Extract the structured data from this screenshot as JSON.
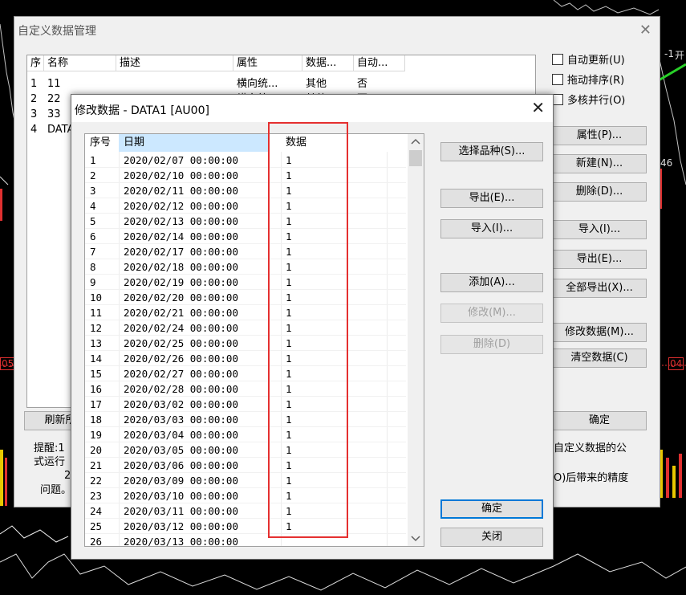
{
  "back_dialog": {
    "title": "自定义数据管理",
    "columns": [
      "序",
      "名称",
      "描述",
      "属性",
      "数据...",
      "自动..."
    ],
    "rows": [
      {
        "no": "1",
        "name": "11",
        "desc": "",
        "attr": "横向统...",
        "data": "其他",
        "auto": "否"
      },
      {
        "no": "2",
        "name": "22",
        "desc": "",
        "attr": "横向统...",
        "data": "其他",
        "auto": "否"
      },
      {
        "no": "3",
        "name": "33",
        "desc": "",
        "attr": "",
        "data": "",
        "auto": ""
      },
      {
        "no": "4",
        "name": "DATA1",
        "desc": "",
        "attr": "",
        "data": "",
        "auto": ""
      }
    ],
    "checkboxes": [
      "自动更新(U)",
      "拖动排序(R)",
      "多核并行(O)"
    ],
    "buttons": {
      "property": "属性(P)...",
      "new": "新建(N)...",
      "delete": "删除(D)...",
      "import": "导入(I)...",
      "export": "导出(E)...",
      "export_all": "全部导出(X)...",
      "modify": "修改数据(M)...",
      "clear": "清空数据(C)",
      "refresh": "刷新所",
      "ok": "确定"
    },
    "notes": {
      "left1": "提醒:1",
      "left2": "式运行",
      "left3": "2",
      "left4": "问题。",
      "right1": "自定义数据的公",
      "right2": "O)后带来的精度"
    }
  },
  "front_dialog": {
    "title": "修改数据 - DATA1 [AU00]",
    "columns": {
      "no": "序号",
      "date": "日期",
      "value": "数据"
    },
    "rows": [
      {
        "no": "1",
        "date": "2020/02/07 00:00:00",
        "value": "1"
      },
      {
        "no": "2",
        "date": "2020/02/10 00:00:00",
        "value": "1"
      },
      {
        "no": "3",
        "date": "2020/02/11 00:00:00",
        "value": "1"
      },
      {
        "no": "4",
        "date": "2020/02/12 00:00:00",
        "value": "1"
      },
      {
        "no": "5",
        "date": "2020/02/13 00:00:00",
        "value": "1"
      },
      {
        "no": "6",
        "date": "2020/02/14 00:00:00",
        "value": "1"
      },
      {
        "no": "7",
        "date": "2020/02/17 00:00:00",
        "value": "1"
      },
      {
        "no": "8",
        "date": "2020/02/18 00:00:00",
        "value": "1"
      },
      {
        "no": "9",
        "date": "2020/02/19 00:00:00",
        "value": "1"
      },
      {
        "no": "10",
        "date": "2020/02/20 00:00:00",
        "value": "1"
      },
      {
        "no": "11",
        "date": "2020/02/21 00:00:00",
        "value": "1"
      },
      {
        "no": "12",
        "date": "2020/02/24 00:00:00",
        "value": "1"
      },
      {
        "no": "13",
        "date": "2020/02/25 00:00:00",
        "value": "1"
      },
      {
        "no": "14",
        "date": "2020/02/26 00:00:00",
        "value": "1"
      },
      {
        "no": "15",
        "date": "2020/02/27 00:00:00",
        "value": "1"
      },
      {
        "no": "16",
        "date": "2020/02/28 00:00:00",
        "value": "1"
      },
      {
        "no": "17",
        "date": "2020/03/02 00:00:00",
        "value": "1"
      },
      {
        "no": "18",
        "date": "2020/03/03 00:00:00",
        "value": "1"
      },
      {
        "no": "19",
        "date": "2020/03/04 00:00:00",
        "value": "1"
      },
      {
        "no": "20",
        "date": "2020/03/05 00:00:00",
        "value": "1"
      },
      {
        "no": "21",
        "date": "2020/03/06 00:00:00",
        "value": "1"
      },
      {
        "no": "22",
        "date": "2020/03/09 00:00:00",
        "value": "1"
      },
      {
        "no": "23",
        "date": "2020/03/10 00:00:00",
        "value": "1"
      },
      {
        "no": "24",
        "date": "2020/03/11 00:00:00",
        "value": "1"
      },
      {
        "no": "25",
        "date": "2020/03/12 00:00:00",
        "value": "1"
      },
      {
        "no": "26",
        "date": "2020/03/13 00:00:00",
        "value": ""
      }
    ],
    "buttons": {
      "select_symbol": "选择品种(S)...",
      "export": "导出(E)...",
      "import": "导入(I)...",
      "add": "添加(A)...",
      "modify": "修改(M)...",
      "delete": "删除(D)",
      "ok": "确定",
      "close": "关闭"
    }
  },
  "background": {
    "labels": [
      "-1",
      "开",
      "46",
      "05",
      "04"
    ]
  },
  "colors": {
    "highlight_box": "#e53030",
    "header_selected": "#cce8ff",
    "chart_background": "#000000"
  }
}
